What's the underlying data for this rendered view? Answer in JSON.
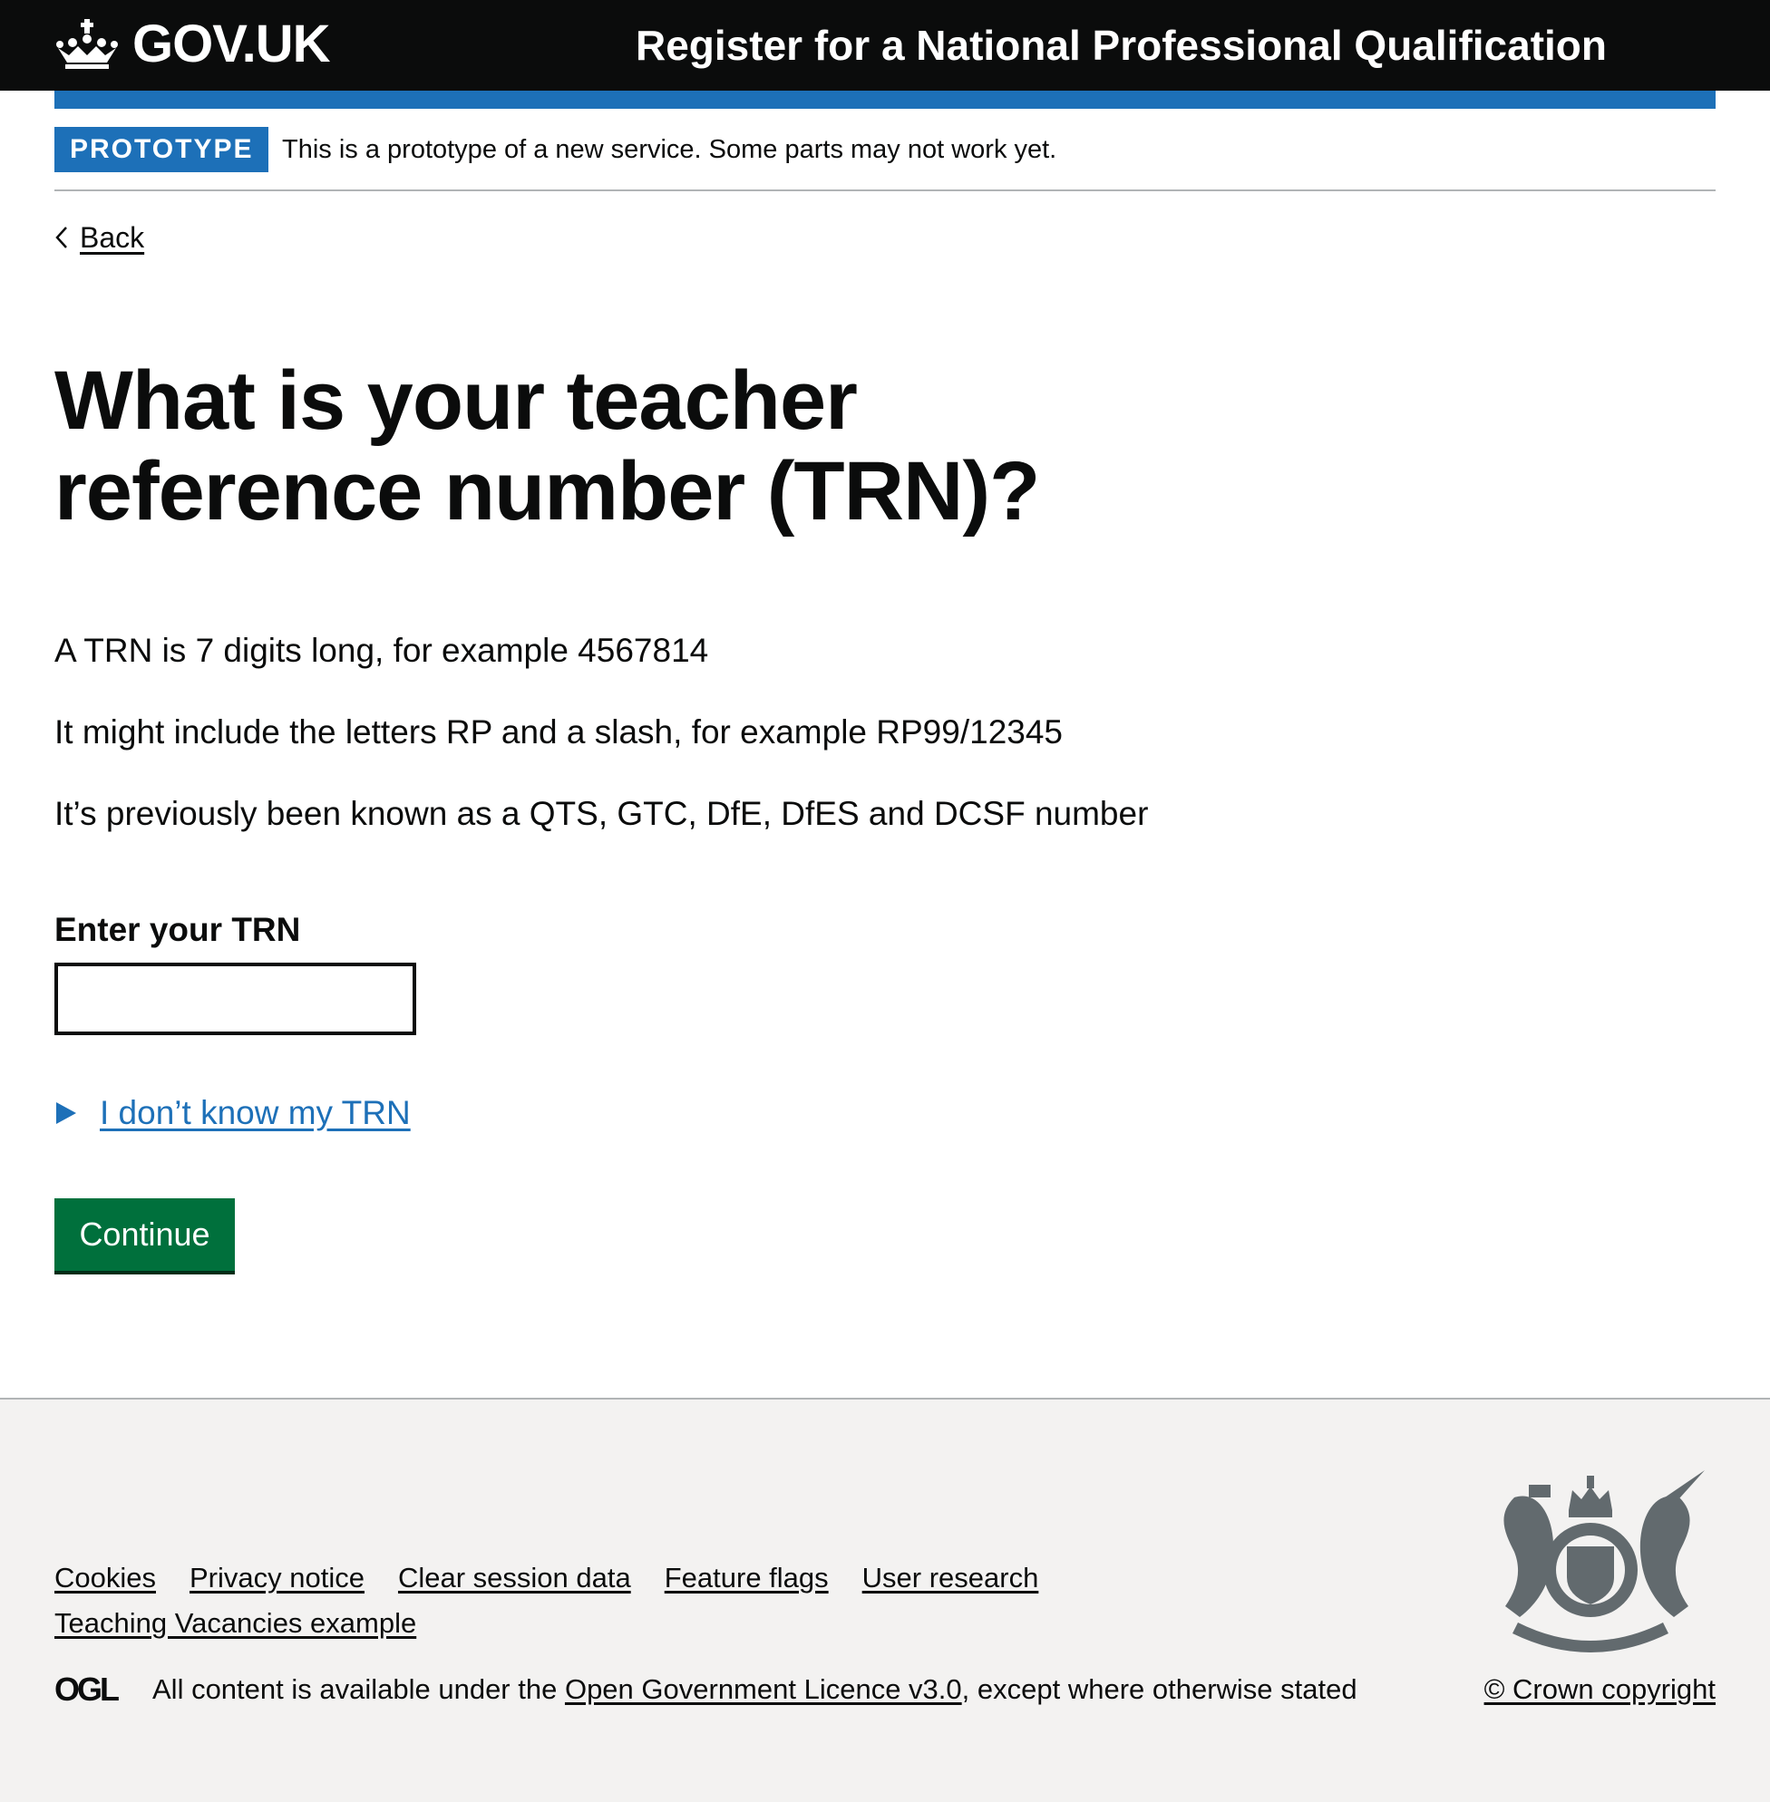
{
  "header": {
    "logo_text": "GOV.UK",
    "service_name": "Register for a National Professional Qualification"
  },
  "phase_banner": {
    "tag": "PROTOTYPE",
    "text": "This is a prototype of a new service. Some parts may not work yet."
  },
  "back_link": "Back",
  "main": {
    "title": "What is your teacher reference number (TRN)?",
    "paragraphs": [
      "A TRN is 7 digits long, for example 4567814",
      "It might include the letters RP and a slash, for example RP99/12345",
      "It’s previously been known as a QTS, GTC, DfE, DfES and DCSF number"
    ],
    "trn_label": "Enter your TRN",
    "trn_value": "",
    "details_summary": "I don’t know my TRN",
    "continue_label": "Continue"
  },
  "footer": {
    "links": [
      "Cookies",
      "Privacy notice",
      "Clear session data",
      "Feature flags",
      "User research",
      "Teaching Vacancies example"
    ],
    "licence_prefix": "All content is available under the ",
    "licence_link": "Open Government Licence v3.0",
    "licence_suffix": ", except where otherwise stated",
    "copyright": "© Crown copyright"
  },
  "colors": {
    "header_bg": "#0b0c0c",
    "brand_blue": "#1d70b8",
    "button_green": "#00703c",
    "footer_bg": "#f3f2f1",
    "crest": "#626a6e"
  },
  "icons": {
    "logo": "crown-icon",
    "back": "chevron-left-icon",
    "details": "triangle-right-icon",
    "licence": "ogl-icon",
    "crest": "royal-coat-of-arms-icon"
  }
}
